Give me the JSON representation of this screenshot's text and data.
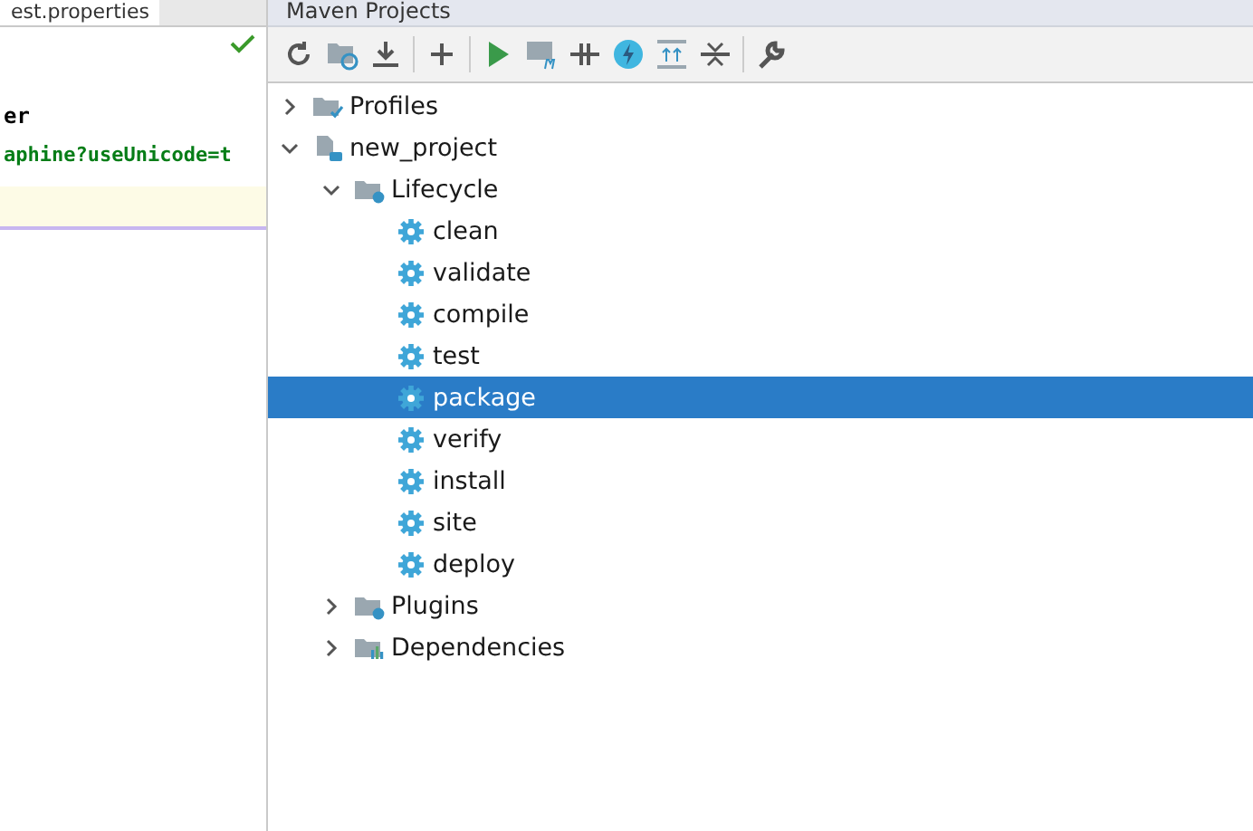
{
  "editor": {
    "tab": {
      "label": "est.properties"
    },
    "lines": [
      {
        "kind": "blank"
      },
      {
        "kind": "key",
        "text": "er"
      },
      {
        "kind": "value",
        "text": "aphine?useUnicode=t"
      },
      {
        "kind": "current"
      }
    ]
  },
  "maven_panel": {
    "title": "Maven Projects",
    "tree": [
      {
        "label": "Profiles",
        "kind": "profiles",
        "expanded": false,
        "selected": false
      },
      {
        "label": "new_project",
        "kind": "project",
        "expanded": true,
        "selected": false,
        "children": [
          {
            "label": "Lifecycle",
            "kind": "lifecycle",
            "expanded": true,
            "selected": false,
            "children": [
              {
                "label": "clean",
                "kind": "goal",
                "selected": false
              },
              {
                "label": "validate",
                "kind": "goal",
                "selected": false
              },
              {
                "label": "compile",
                "kind": "goal",
                "selected": false
              },
              {
                "label": "test",
                "kind": "goal",
                "selected": false
              },
              {
                "label": "package",
                "kind": "goal",
                "selected": true
              },
              {
                "label": "verify",
                "kind": "goal",
                "selected": false
              },
              {
                "label": "install",
                "kind": "goal",
                "selected": false
              },
              {
                "label": "site",
                "kind": "goal",
                "selected": false
              },
              {
                "label": "deploy",
                "kind": "goal",
                "selected": false
              }
            ]
          },
          {
            "label": "Plugins",
            "kind": "plugins",
            "expanded": false,
            "selected": false
          },
          {
            "label": "Dependencies",
            "kind": "dependencies",
            "expanded": false,
            "selected": false
          }
        ]
      }
    ]
  }
}
